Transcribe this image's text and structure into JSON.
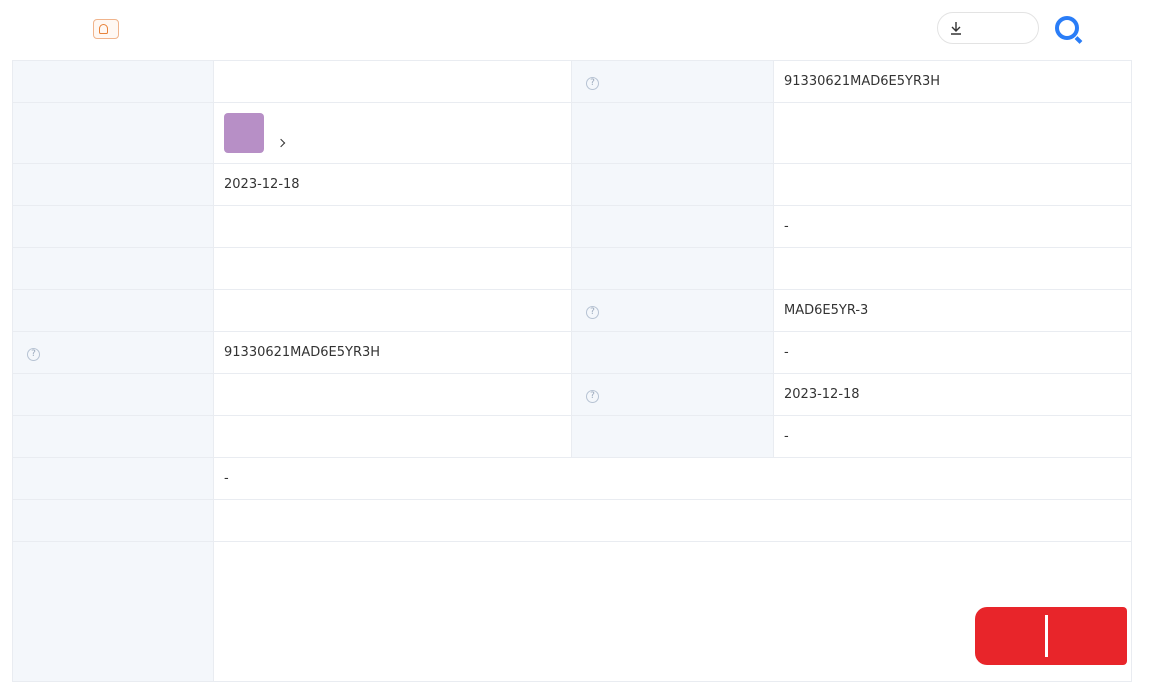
{
  "header": {
    "title": "",
    "remind_label": "",
    "download_label": "",
    "brand_name": ""
  },
  "rows": [
    {
      "label1": "",
      "value1": "",
      "label2": "",
      "label2_help": "?",
      "value2": "91330621MAD6E5YR3H"
    },
    {
      "label1": "",
      "person": {
        "avatar_char": "",
        "name": "",
        "company_count": ""
      },
      "label2": "",
      "value2": ""
    },
    {
      "label1": "",
      "value1": "2023-12-18",
      "label2": "",
      "value2": ""
    },
    {
      "label1": "",
      "value1": "",
      "label2": "",
      "value2": "-"
    },
    {
      "label1": "",
      "value1": "",
      "label2": "",
      "value2": ""
    },
    {
      "label1": "",
      "value1": "",
      "label2": "",
      "label2_help": "?",
      "value2": "MAD6E5YR-3"
    },
    {
      "label1": "",
      "label1_help": "?",
      "value1": "91330621MAD6E5YR3H",
      "label2": "",
      "value2": "-"
    },
    {
      "label1": "",
      "value1": "",
      "label2": "",
      "label2_help": "?",
      "value2": "2023-12-18"
    },
    {
      "label1": "",
      "value1": "",
      "label2": "",
      "value2": "-"
    }
  ],
  "former_name": {
    "label": "",
    "value": "-"
  },
  "address": {
    "label": "",
    "value": "",
    "map_link": ""
  },
  "scope": {
    "label": "",
    "lines": [
      "",
      "",
      "",
      "",
      ""
    ]
  },
  "stamp": {
    "part1": "",
    "part2": ""
  },
  "colors": {
    "accent_link": "#1e57c6",
    "label_bg": "#f4f7fb",
    "remind_orange": "#e8833a",
    "brand_blue": "#2a7df7",
    "stamp_red": "#e8252a"
  }
}
